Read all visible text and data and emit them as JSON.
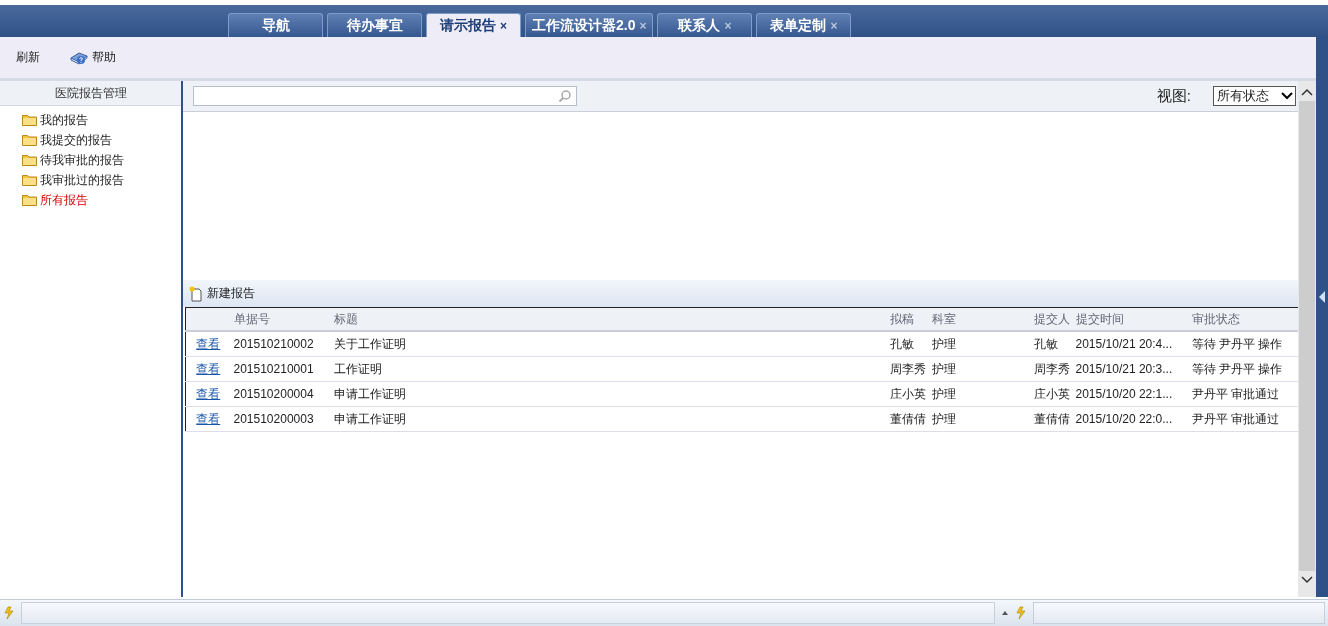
{
  "tabs": [
    {
      "label": "导航",
      "selected": false
    },
    {
      "label": "待办事宜",
      "selected": false
    },
    {
      "label": "请示报告",
      "selected": true,
      "close": "×"
    },
    {
      "label": "工作流设计器2.0",
      "selected": false,
      "close": "×"
    },
    {
      "label": "联系人",
      "selected": false,
      "close": "×"
    },
    {
      "label": "表单定制",
      "selected": false,
      "close": "×"
    }
  ],
  "toolbar": [
    {
      "label": "刷新",
      "kind": "text"
    },
    {
      "label": "帮助",
      "kind": "help"
    }
  ],
  "sidebar": {
    "title": "医院报告管理",
    "items": [
      {
        "label": "我的报告",
        "selected": false
      },
      {
        "label": "我提交的报告",
        "selected": false
      },
      {
        "label": "待我审批的报告",
        "selected": false
      },
      {
        "label": "我审批过的报告",
        "selected": false
      },
      {
        "label": "所有报告",
        "selected": true
      }
    ]
  },
  "view_filter": {
    "label": "视图:",
    "value": "所有状态"
  },
  "new_report_button": "新建报告",
  "table": {
    "columns": [
      "单据号",
      "标题",
      "拟稿",
      "科室",
      "提交人",
      "提交时间",
      "审批状态"
    ],
    "rows": [
      {
        "action": "查看",
        "cells": [
          "201510210002",
          "关于工作证明",
          "孔敏",
          "护理",
          "孔敏",
          "2015/10/21 20:4...",
          "等待 尹丹平 操作"
        ]
      },
      {
        "action": "查看",
        "cells": [
          "201510210001",
          "工作证明",
          "周李秀",
          "护理",
          "周李秀",
          "2015/10/21 20:3...",
          "等待 尹丹平 操作"
        ]
      },
      {
        "action": "查看",
        "cells": [
          "201510200004",
          "申请工作证明",
          "庄小英",
          "护理",
          "庄小英",
          "2015/10/20 22:1...",
          "尹丹平 审批通过"
        ]
      },
      {
        "action": "查看",
        "cells": [
          "201510200003",
          "申请工作证明",
          "董倩倩",
          "护理",
          "董倩倩",
          "2015/10/20 22:0...",
          "尹丹平 审批通过"
        ]
      }
    ]
  }
}
